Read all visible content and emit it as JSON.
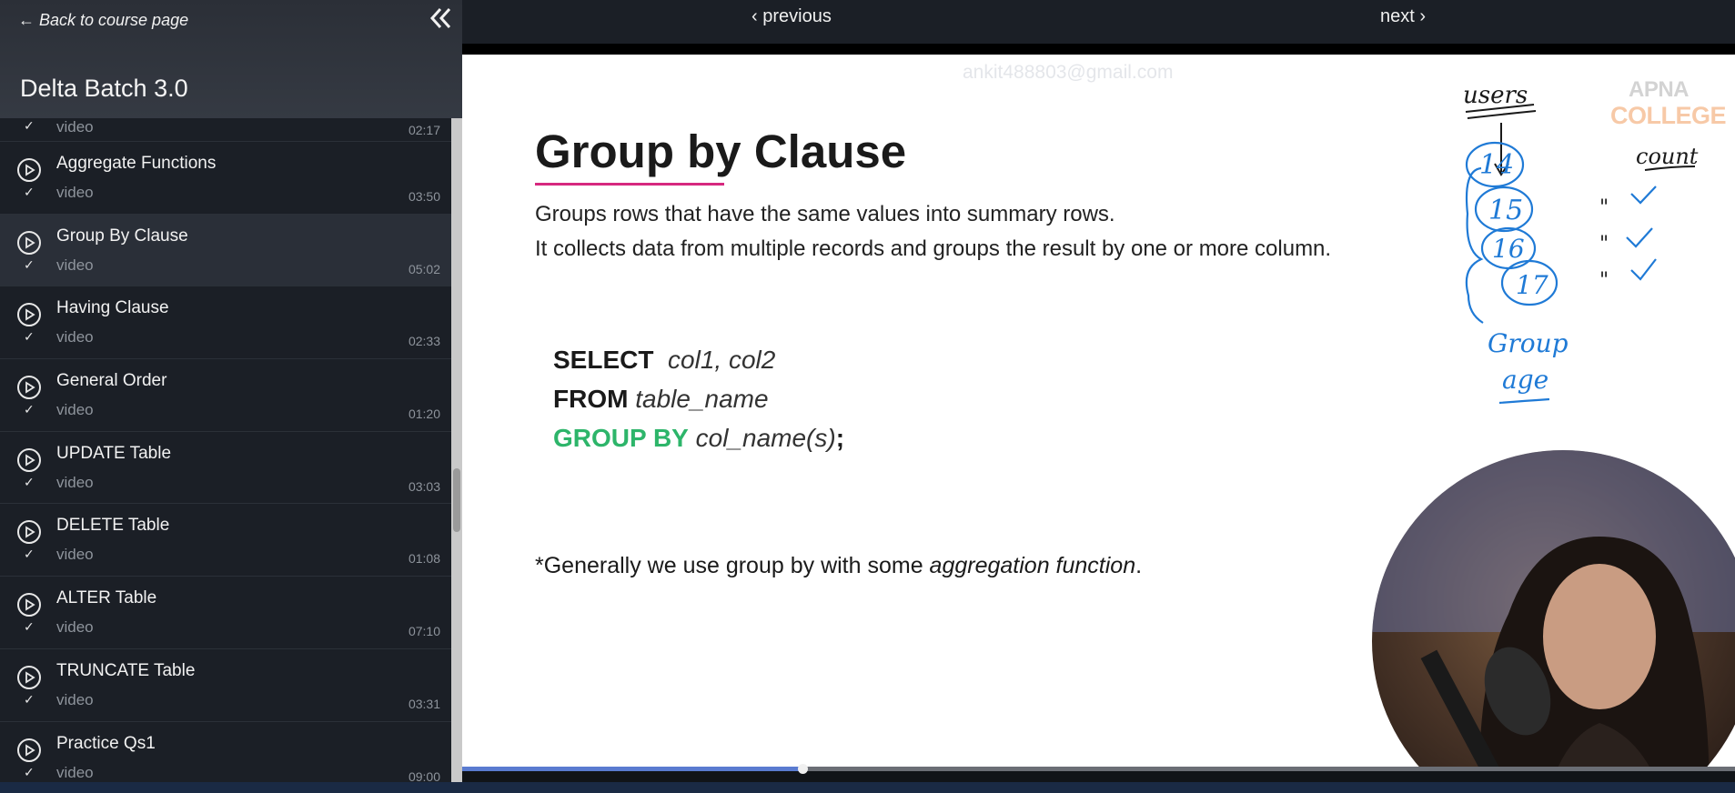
{
  "sidebar": {
    "back_label": "← Back to course page",
    "course_title": "Delta Batch 3.0",
    "items": [
      {
        "title": "",
        "type": "video",
        "duration": "02:17"
      },
      {
        "title": "Aggregate Functions",
        "type": "video",
        "duration": "03:50"
      },
      {
        "title": "Group By Clause",
        "type": "video",
        "duration": "05:02",
        "active": true
      },
      {
        "title": "Having Clause",
        "type": "video",
        "duration": "02:33"
      },
      {
        "title": "General Order",
        "type": "video",
        "duration": "01:20"
      },
      {
        "title": "UPDATE Table",
        "type": "video",
        "duration": "03:03"
      },
      {
        "title": "DELETE Table",
        "type": "video",
        "duration": "01:08"
      },
      {
        "title": "ALTER Table",
        "type": "video",
        "duration": "07:10"
      },
      {
        "title": "TRUNCATE Table",
        "type": "video",
        "duration": "03:31"
      },
      {
        "title": "Practice Qs1",
        "type": "video",
        "duration": "09:00"
      }
    ]
  },
  "nav": {
    "previous_label": "‹ previous",
    "next_label": "next ›"
  },
  "slide": {
    "watermark": "ankit488803@gmail.com",
    "logo_line1": "APNA",
    "logo_line2": "COLLEGE",
    "title": "Group by Clause",
    "desc_line1": "Groups rows that have the same values into summary rows.",
    "desc_line2": "It collects data from multiple records and groups the result by one or more column.",
    "sql_line1_kw": "SELECT",
    "sql_line1_rest": "col1, col2",
    "sql_line2_kw": "FROM",
    "sql_line2_rest": "table_name",
    "sql_line3_kw": "GROUP BY",
    "sql_line3_rest": "col_name(s)",
    "sql_line3_end": ";",
    "footnote_pre": "*Generally we use group by with some ",
    "footnote_em": "aggregation function",
    "footnote_post": ".",
    "handwriting": {
      "users": "users",
      "values": [
        "14",
        "15",
        "16",
        "17"
      ],
      "count": "count",
      "ditto": "\"",
      "group": "Group",
      "age": "age"
    }
  },
  "player": {
    "progress_fraction": 0.267,
    "accent": "#5a7bd0"
  },
  "colors": {
    "sql_green": "#2db56a",
    "underline_pink": "#d6287f",
    "ink_blue": "#1f7ad6"
  }
}
